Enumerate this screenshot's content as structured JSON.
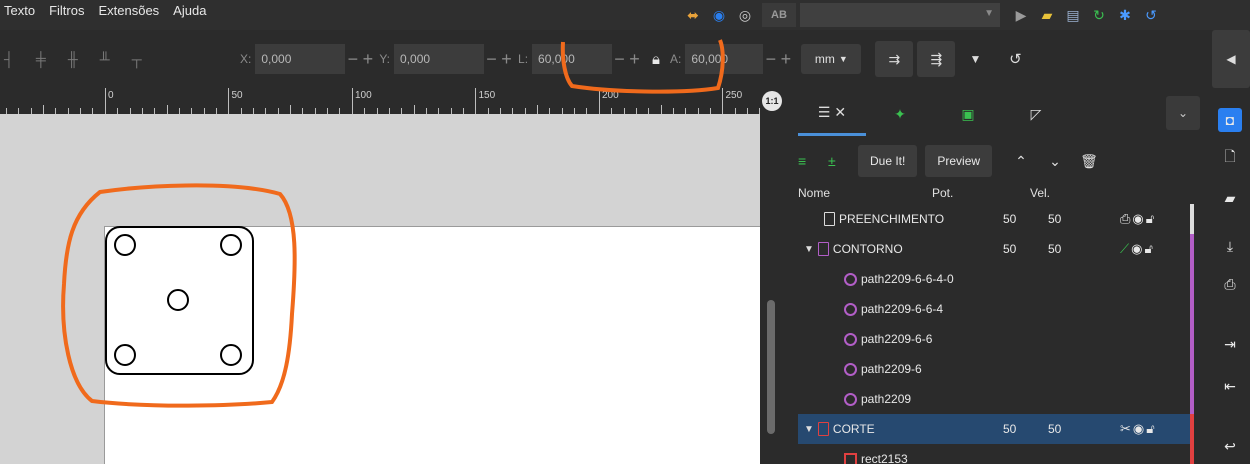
{
  "menu": [
    "Texto",
    "Filtros",
    "Extensões",
    "Ajuda"
  ],
  "top_toolbar": {
    "ab_label": "AB",
    "font_value": ""
  },
  "transform": {
    "x_label": "X:",
    "x_value": "0,000",
    "y_label": "Y:",
    "y_value": "0,000",
    "l_label": "L:",
    "l_value": "60,000",
    "a_label": "A:",
    "a_value": "60,000",
    "unit": "mm"
  },
  "ruler": {
    "labels": [
      "0",
      "50",
      "100",
      "150",
      "200",
      "250"
    ]
  },
  "panel": {
    "due_label": "Due It!",
    "preview_label": "Preview",
    "col_name": "Nome",
    "col_pot": "Pot.",
    "col_vel": "Vel.",
    "rows": [
      {
        "name": "PREENCHIMENTO",
        "pot": "50",
        "vel": "50",
        "type": "layer",
        "color": "#dddddd",
        "stripe": "#dddddd"
      },
      {
        "name": "CONTORNO",
        "pot": "50",
        "vel": "50",
        "type": "layer",
        "color": "#b25ec7",
        "stripe": "#b25ec7"
      },
      {
        "name": "path2209-6-6-4-0",
        "type": "path",
        "stripe": "#b25ec7"
      },
      {
        "name": "path2209-6-6-4",
        "type": "path",
        "stripe": "#b25ec7"
      },
      {
        "name": "path2209-6-6",
        "type": "path",
        "stripe": "#b25ec7"
      },
      {
        "name": "path2209-6",
        "type": "path",
        "stripe": "#b25ec7"
      },
      {
        "name": "path2209",
        "type": "path",
        "stripe": "#b25ec7"
      },
      {
        "name": "CORTE",
        "pot": "50",
        "vel": "50",
        "type": "layer",
        "color": "#e04040",
        "stripe": "#e04040",
        "selected": true
      },
      {
        "name": "rect2153",
        "type": "rect",
        "stripe": "#e04040"
      }
    ]
  },
  "colors": {
    "accent_blue": "#4a90d9",
    "annotation_orange": "#f06a1c",
    "contorno_purple": "#b25ec7",
    "corte_red": "#e04040"
  }
}
